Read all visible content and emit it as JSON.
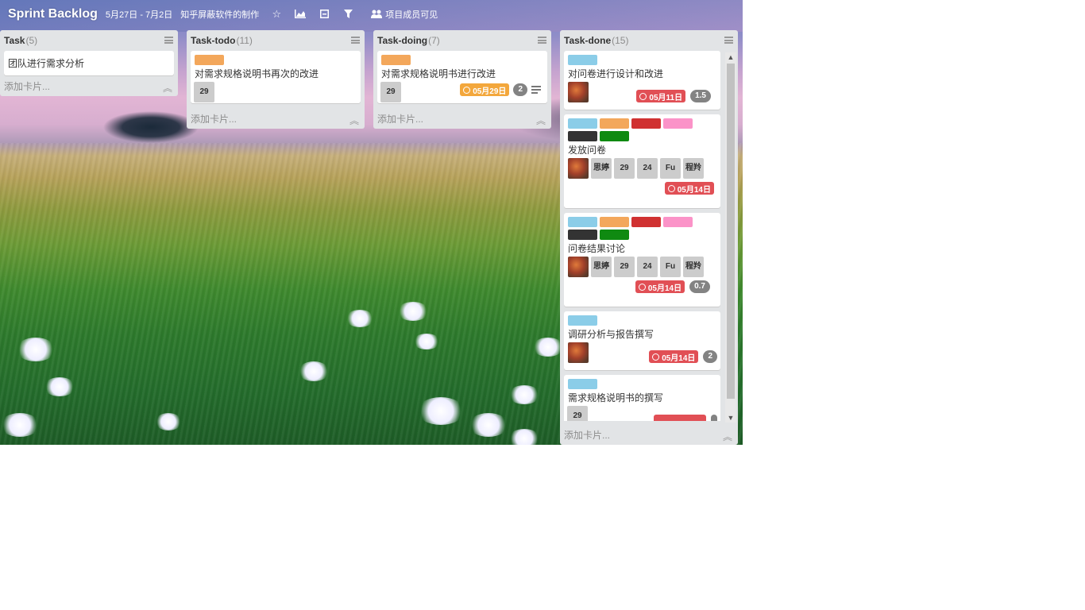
{
  "header": {
    "title": "Sprint Backlog",
    "dates": "5月27日 - 7月2日",
    "project": "知乎屏蔽软件的制作",
    "members_label": "项目成员可见",
    "icons": [
      "star-icon",
      "chart-icon",
      "collapse-icon",
      "filter-icon",
      "members-icon"
    ]
  },
  "lists": {
    "task": {
      "name": "Task",
      "count": "(5)",
      "add_label": "添加卡片...",
      "card1": {
        "title": "团队进行需求分析"
      }
    },
    "todo": {
      "name": "Task-todo",
      "count": "(11)",
      "add_label": "添加卡片...",
      "card1": {
        "title": "对需求规格说明书再次的改进",
        "label_color": "#f3a75b",
        "chip": "29"
      }
    },
    "doing": {
      "name": "Task-doing",
      "count": "(7)",
      "add_label": "添加卡片...",
      "card1": {
        "title": "对需求规格说明书进行改进",
        "label_color": "#f3a75b",
        "chip": "29",
        "due": "05月29日",
        "count": "2"
      }
    },
    "done": {
      "name": "Task-done",
      "count": "(15)",
      "add_label": "添加卡片...",
      "card1": {
        "title": "对问卷进行设计和改进",
        "due": "05月11日",
        "pill": "1.5"
      },
      "card2": {
        "title": "发放问卷",
        "chips": [
          "思婷",
          "29",
          "24",
          "Fu",
          "程羚"
        ],
        "due": "05月14日"
      },
      "card3": {
        "title": "问卷结果讨论",
        "chips": [
          "思婷",
          "29",
          "24",
          "Fu",
          "程羚"
        ],
        "due": "05月14日",
        "pill": "0.7"
      },
      "card4": {
        "title": "调研分析与报告撰写",
        "due": "05月14日",
        "pill": "2"
      },
      "card5": {
        "title": "需求规格说明书的撰写",
        "chip": "29"
      }
    }
  },
  "colors": {
    "label_blue": "#8bcde8",
    "label_orange": "#f3a75b",
    "label_red": "#d03131",
    "label_pink": "#fb93c8",
    "label_black": "#333333",
    "label_green": "#0f8a11",
    "due_red": "#e14f55",
    "due_orange": "#f3a73c"
  }
}
